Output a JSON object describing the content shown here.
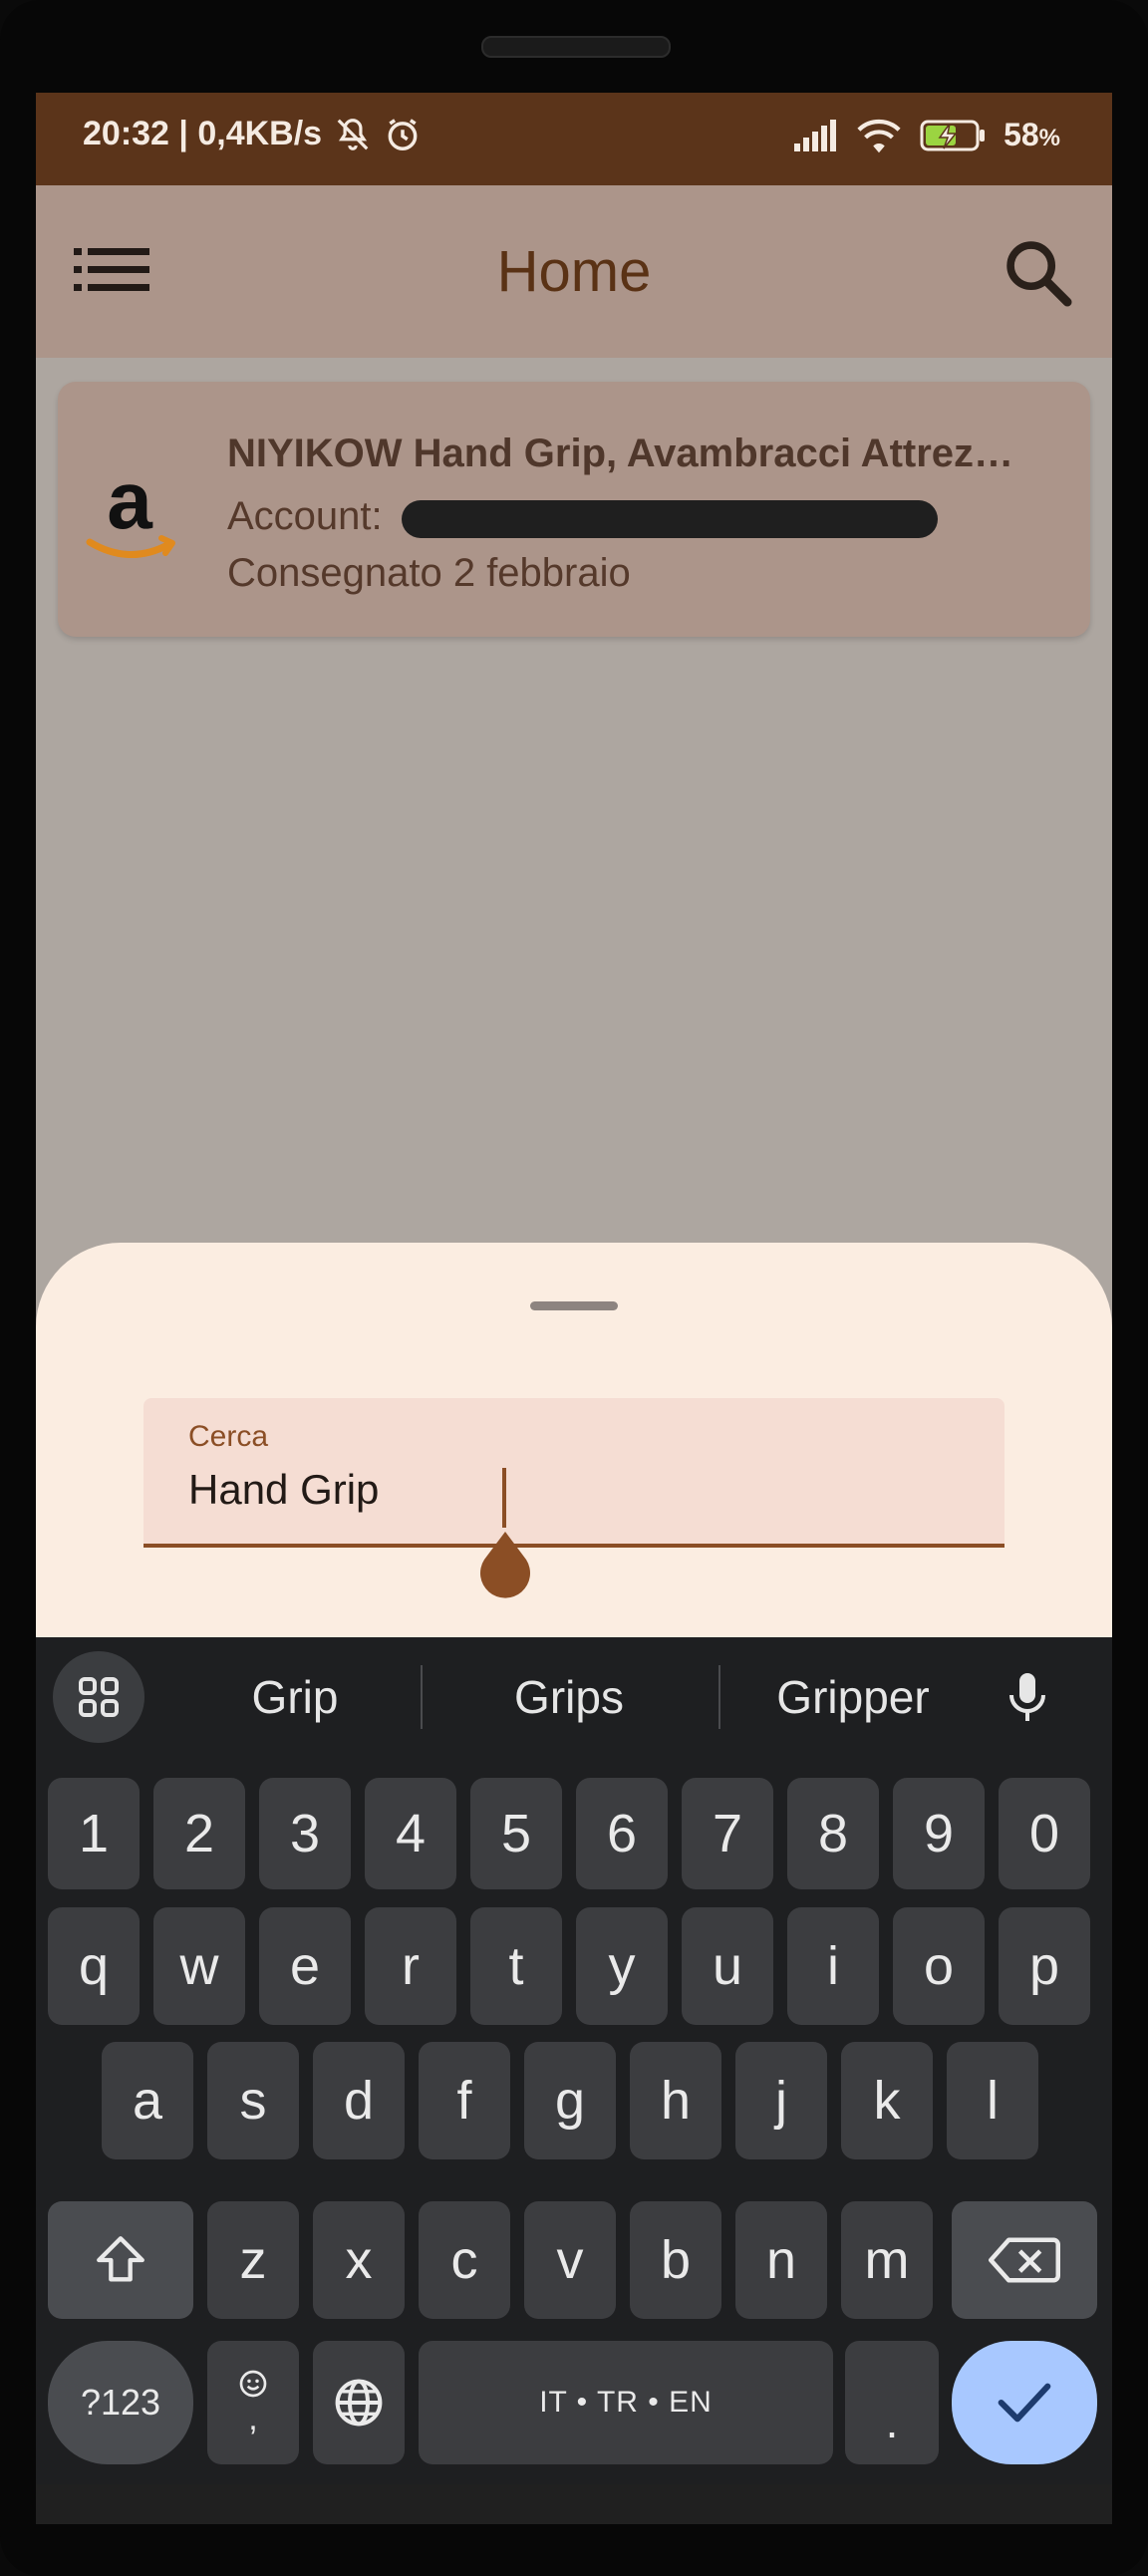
{
  "status_bar": {
    "time_speed": "20:32 | 0,4KB/s",
    "battery": "58",
    "battery_unit": "%",
    "icons": [
      "notifications-off-icon",
      "alarm-icon",
      "signal-icon",
      "wifi-icon",
      "battery-charging-icon"
    ]
  },
  "app_bar": {
    "title": "Home",
    "menu_icon": "list-menu-icon",
    "search_icon": "search-icon"
  },
  "orders": [
    {
      "store_icon": "amazon-logo",
      "title": "NIYIKOW Hand Grip, Avambracci Attrez…",
      "account_label": "Account: ",
      "account_value_redacted": true,
      "status": "Consegnato 2 febbraio"
    }
  ],
  "search_sheet": {
    "field_label": "Cerca",
    "field_value": "Hand Grip"
  },
  "keyboard": {
    "suggestions": [
      "Grip",
      "Grips",
      "Gripper"
    ],
    "number_row": [
      "1",
      "2",
      "3",
      "4",
      "5",
      "6",
      "7",
      "8",
      "9",
      "0"
    ],
    "row1": [
      "q",
      "w",
      "e",
      "r",
      "t",
      "y",
      "u",
      "i",
      "o",
      "p"
    ],
    "row2": [
      "a",
      "s",
      "d",
      "f",
      "g",
      "h",
      "j",
      "k",
      "l"
    ],
    "row3": [
      "z",
      "x",
      "c",
      "v",
      "b",
      "n",
      "m"
    ],
    "symbols_label": "?123",
    "emoji_comma_label": ",",
    "space_label": "IT • TR • EN",
    "period_label": ".",
    "colors": {
      "done_key": "#a8c8ff",
      "key": "#3c3d40",
      "background": "#1e1f21"
    }
  },
  "colors": {
    "status_bar": "#5b341a",
    "app_bar": "#ac958a",
    "accent": "#8b4e25",
    "sheet": "#fbede1"
  }
}
